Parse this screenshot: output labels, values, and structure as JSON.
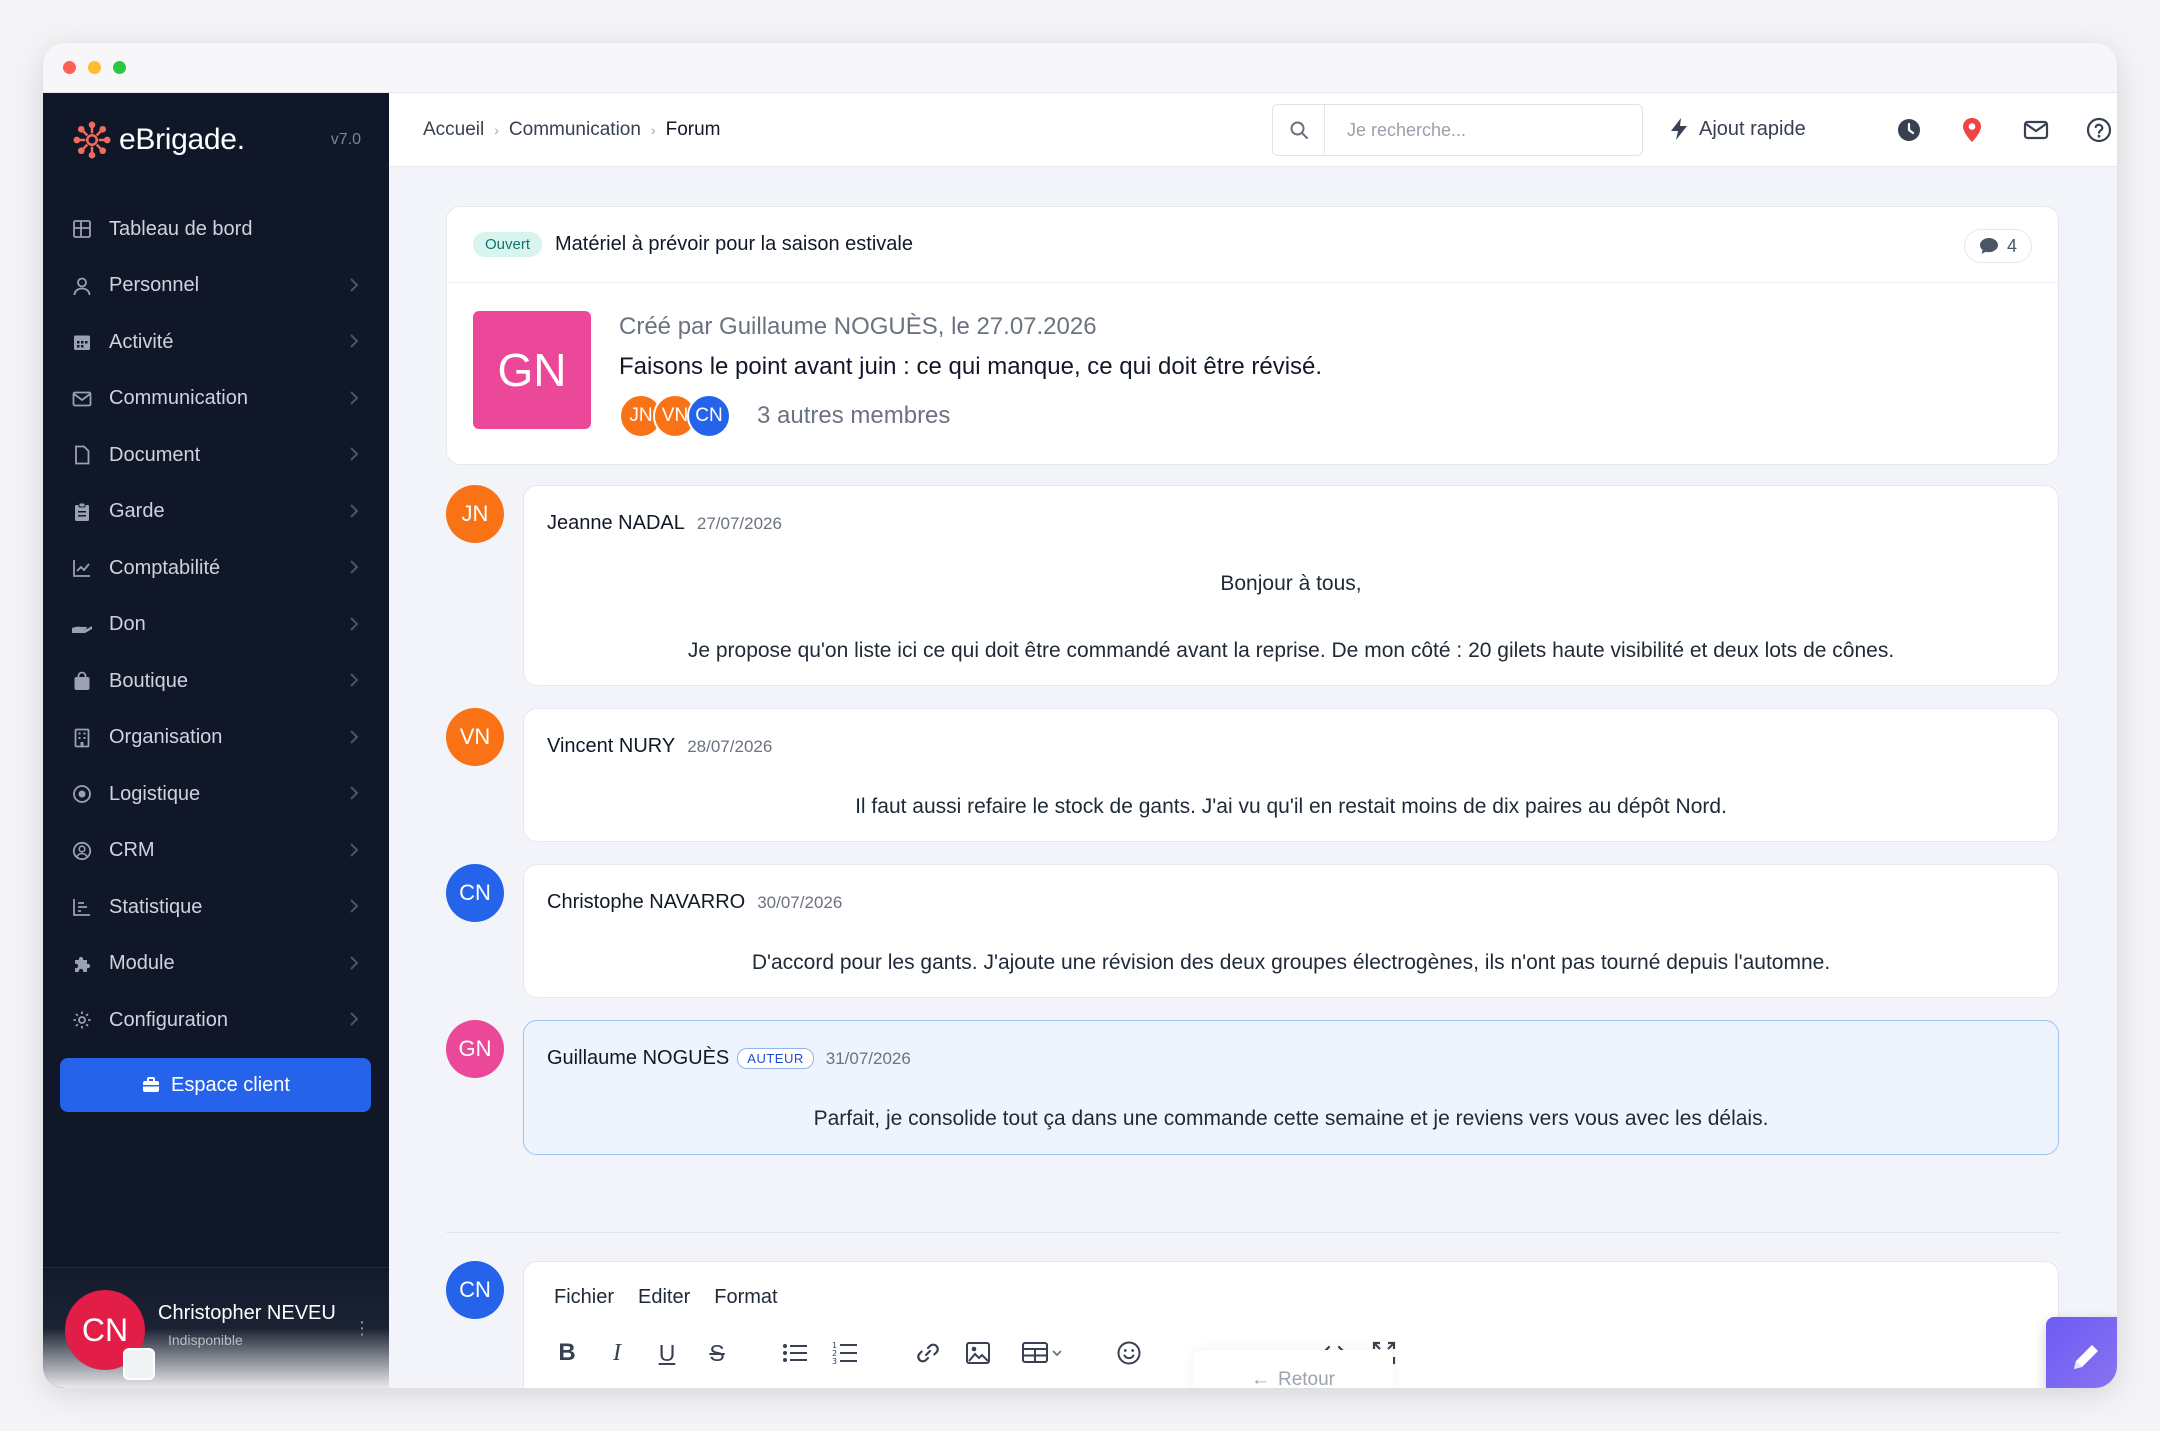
{
  "app": {
    "brand": "eBrigade.",
    "version": "v7.0"
  },
  "sidebar": {
    "items": [
      {
        "label": "Tableau de bord",
        "icon": "dashboard-icon",
        "has_children": false
      },
      {
        "label": "Personnel",
        "icon": "user-icon",
        "has_children": true
      },
      {
        "label": "Activité",
        "icon": "calendar-icon",
        "has_children": true
      },
      {
        "label": "Communication",
        "icon": "envelope-icon",
        "has_children": true
      },
      {
        "label": "Document",
        "icon": "file-icon",
        "has_children": true
      },
      {
        "label": "Garde",
        "icon": "clipboard-icon",
        "has_children": true
      },
      {
        "label": "Comptabilité",
        "icon": "line-chart-icon",
        "has_children": true
      },
      {
        "label": "Don",
        "icon": "hand-icon",
        "has_children": true
      },
      {
        "label": "Boutique",
        "icon": "shopping-bag-icon",
        "has_children": true
      },
      {
        "label": "Organisation",
        "icon": "building-icon",
        "has_children": true
      },
      {
        "label": "Logistique",
        "icon": "target-icon",
        "has_children": true
      },
      {
        "label": "CRM",
        "icon": "contact-icon",
        "has_children": true
      },
      {
        "label": "Statistique",
        "icon": "bar-chart-icon",
        "has_children": true
      },
      {
        "label": "Module",
        "icon": "puzzle-icon",
        "has_children": true
      },
      {
        "label": "Configuration",
        "icon": "gear-icon",
        "has_children": true
      }
    ],
    "client_button": "Espace client",
    "user": {
      "initials": "CN",
      "name": "Christopher NEVEU",
      "status": "Indisponible"
    }
  },
  "topbar": {
    "breadcrumb": [
      "Accueil",
      "Communication",
      "Forum"
    ],
    "search_placeholder": "Je recherche...",
    "quick_add": "Ajout rapide"
  },
  "topic": {
    "status": "Ouvert",
    "title": "Matériel à prévoir pour la saison estivale",
    "comment_count": "4",
    "author_initials": "GN",
    "meta": "Créé par Guillaume NOGUÈS, le 27.07.2026",
    "description": "Faisons le point avant juin : ce qui manque, ce qui doit être révisé.",
    "members": [
      "JN",
      "VN",
      "CN"
    ],
    "members_label": "3 autres membres"
  },
  "posts": [
    {
      "initials": "JN",
      "name": "Jeanne NADAL",
      "date": "27/07/2026",
      "lines": [
        "Bonjour à tous,",
        "Je propose qu'on liste ici ce qui doit être commandé avant la reprise. De mon côté : 20 gilets haute visibilité et deux lots de cônes."
      ]
    },
    {
      "initials": "VN",
      "name": "Vincent NURY",
      "date": "28/07/2026",
      "lines": [
        "Il faut aussi refaire le stock de gants. J'ai vu qu'il en restait moins de dix paires au dépôt Nord."
      ]
    },
    {
      "initials": "CN",
      "name": "Christophe NAVARRO",
      "date": "30/07/2026",
      "lines": [
        "D'accord pour les gants. J'ajoute une révision des deux groupes électrogènes, ils n'ont pas tourné depuis l'automne."
      ]
    },
    {
      "initials": "GN",
      "name": "Guillaume NOGUÈS",
      "author_tag": "AUTEUR",
      "date": "31/07/2026",
      "lines": [
        "Parfait, je consolide tout ça dans une commande cette semaine et je reviens vers vous avec les délais."
      ]
    }
  ],
  "editor": {
    "avatar": "CN",
    "menu": [
      "Fichier",
      "Editer",
      "Format"
    ]
  },
  "retour_label": "Retour",
  "colors": {
    "orange": "#f97316",
    "blue": "#2563eb",
    "pink": "#ec4899",
    "sidebar": "#0f1729",
    "accent": "#2563eb"
  }
}
